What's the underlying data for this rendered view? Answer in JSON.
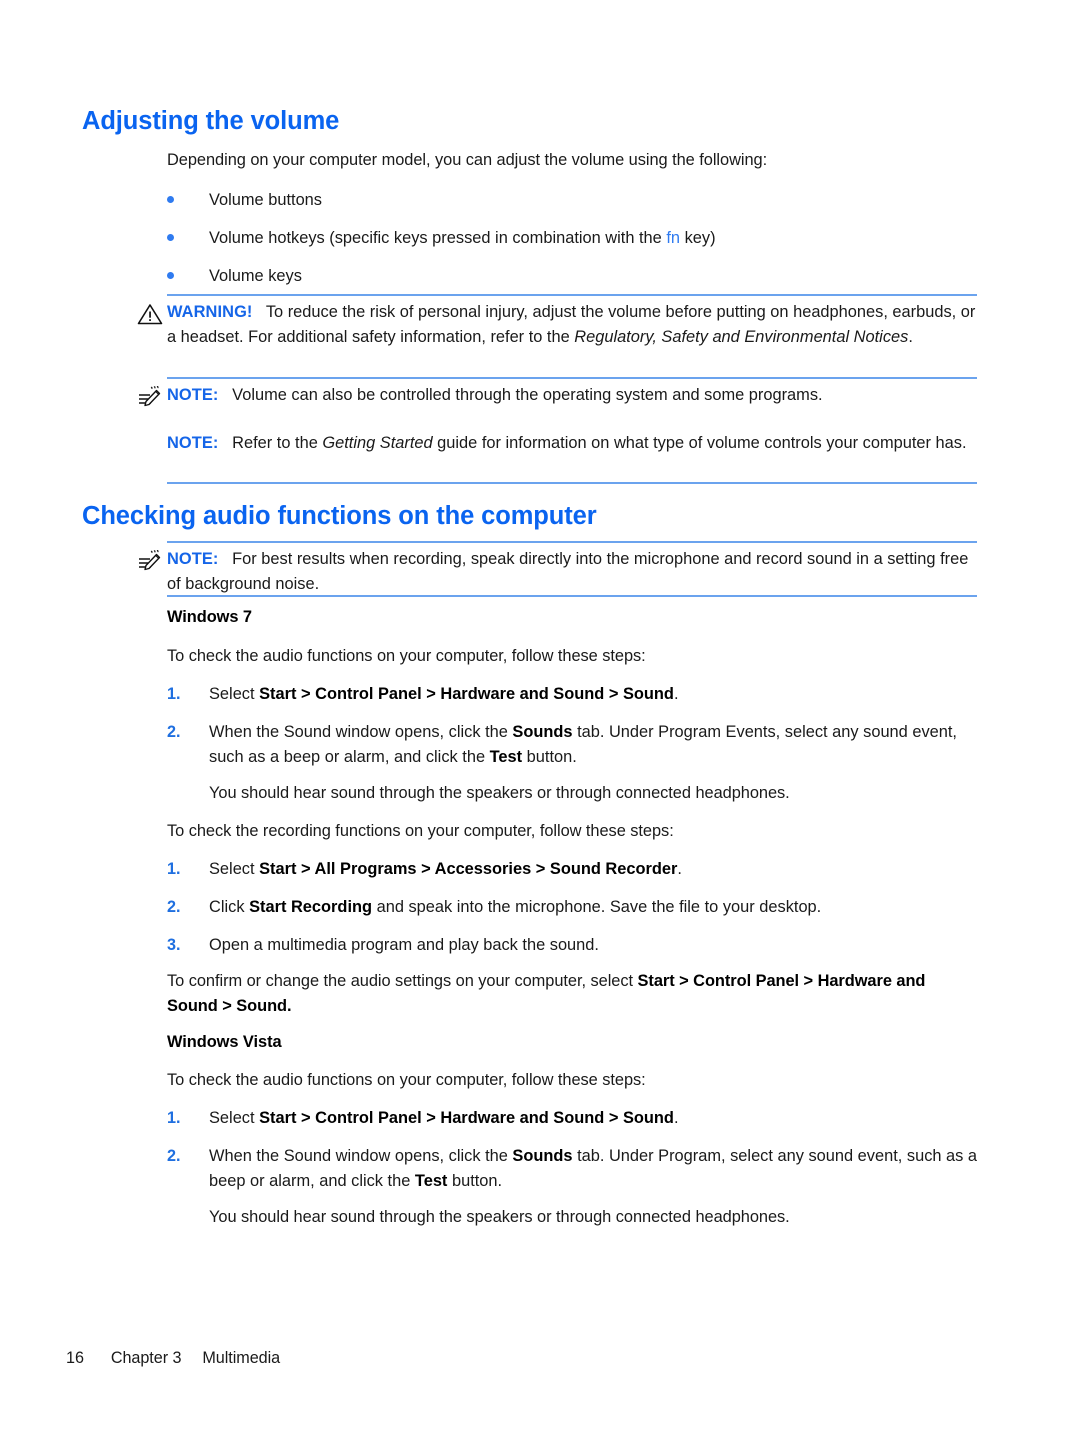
{
  "page": {
    "footer": {
      "page_number": "16",
      "chapter": "Chapter 3",
      "section": "Multimedia"
    },
    "colors": {
      "heading_blue": "#0a64f0",
      "rule_blue": "#6ba3ee",
      "label_blue": "#1565e8",
      "bullet_blue": "#2f7bf0",
      "number_blue": "#1f6fe0"
    }
  },
  "section_volume": {
    "heading": "Adjusting the volume",
    "intro": "Depending on your computer model, you can adjust the volume using the following:",
    "bullets": [
      {
        "text": "Volume buttons"
      },
      {
        "pre": "Volume hotkeys (specific keys pressed in combination with the ",
        "key": "fn",
        "post": " key)"
      },
      {
        "text": "Volume keys"
      }
    ],
    "warning": {
      "icon": "warning-triangle-icon",
      "label": "WARNING!",
      "text_part1": "To reduce the risk of personal injury, adjust the volume before putting on headphones, earbuds, or a headset. For additional safety information, refer to the ",
      "italic_title": "Regulatory, Safety and Environmental Notices",
      "text_part2": "."
    },
    "note_icon": {
      "icon": "note-pencil-icon",
      "label": "NOTE:",
      "text": "Volume can also be controlled through the operating system and some programs."
    },
    "note_plain": {
      "label": "NOTE:",
      "text_part1": "Refer to the ",
      "italic_title": "Getting Started",
      "text_part2": " guide for information on what type of volume controls your computer has."
    }
  },
  "section_audio": {
    "heading": "Checking audio functions on the computer",
    "note": {
      "icon": "note-pencil-icon",
      "label": "NOTE:",
      "text": "For best results when recording, speak directly into the microphone and record sound in a setting free of background noise."
    },
    "win7": {
      "subheading": "Windows 7",
      "audio_intro": "To check the audio functions on your computer, follow these steps:",
      "audio_steps": [
        {
          "num": "1.",
          "parts": [
            {
              "t": "Select ",
              "b": false
            },
            {
              "t": "Start > Control Panel > Hardware and Sound > Sound",
              "b": true
            },
            {
              "t": ".",
              "b": false
            }
          ]
        },
        {
          "num": "2.",
          "parts": [
            {
              "t": "When the Sound window opens, click the ",
              "b": false
            },
            {
              "t": "Sounds",
              "b": true
            },
            {
              "t": " tab. Under Program Events, select any sound event, such as a beep or alarm, and click the ",
              "b": false
            },
            {
              "t": "Test",
              "b": true
            },
            {
              "t": " button.",
              "b": false
            }
          ]
        }
      ],
      "audio_result": "You should hear sound through the speakers or through connected headphones.",
      "record_intro": "To check the recording functions on your computer, follow these steps:",
      "record_steps": [
        {
          "num": "1.",
          "parts": [
            {
              "t": "Select ",
              "b": false
            },
            {
              "t": "Start > All Programs > Accessories > Sound Recorder",
              "b": true
            },
            {
              "t": ".",
              "b": false
            }
          ]
        },
        {
          "num": "2.",
          "parts": [
            {
              "t": "Click ",
              "b": false
            },
            {
              "t": "Start Recording",
              "b": true
            },
            {
              "t": " and speak into the microphone. Save the file to your desktop.",
              "b": false
            }
          ]
        },
        {
          "num": "3.",
          "parts": [
            {
              "t": "Open a multimedia program and play back the sound.",
              "b": false
            }
          ]
        }
      ],
      "confirm_parts": [
        {
          "t": "To confirm or change the audio settings on your computer, select ",
          "b": false
        },
        {
          "t": "Start > Control Panel > Hardware and Sound > Sound",
          "b": true
        },
        {
          "t": ".",
          "b": false
        }
      ]
    },
    "vista": {
      "subheading": "Windows Vista",
      "audio_intro": "To check the audio functions on your computer, follow these steps:",
      "audio_steps": [
        {
          "num": "1.",
          "parts": [
            {
              "t": "Select ",
              "b": false
            },
            {
              "t": "Start > Control Panel > Hardware and Sound > Sound",
              "b": true
            },
            {
              "t": ".",
              "b": false
            }
          ]
        },
        {
          "num": "2.",
          "parts": [
            {
              "t": "When the Sound window opens, click the ",
              "b": false
            },
            {
              "t": "Sounds",
              "b": true
            },
            {
              "t": " tab. Under Program, select any sound event, such as a beep or alarm, and click the ",
              "b": false
            },
            {
              "t": "Test",
              "b": true
            },
            {
              "t": " button.",
              "b": false
            }
          ]
        }
      ],
      "audio_result": "You should hear sound through the speakers or through connected headphones."
    }
  }
}
